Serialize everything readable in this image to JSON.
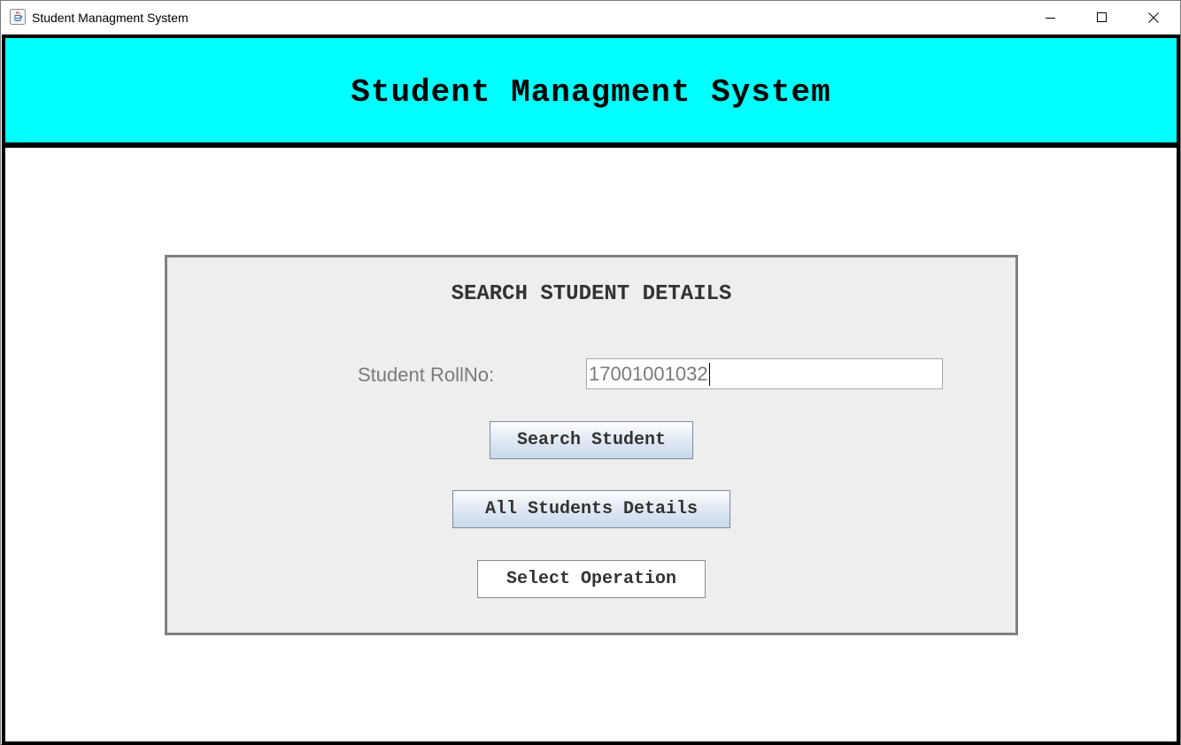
{
  "window": {
    "title": "Student Managment System",
    "controls": {
      "minimize_icon": "minimize-icon",
      "maximize_icon": "maximize-icon",
      "close_icon": "close-icon"
    }
  },
  "header": {
    "title": "Student Managment System",
    "background_color": "#00ffff"
  },
  "search_panel": {
    "title": "SEARCH STUDENT DETAILS",
    "roll_label": "Student RollNo:",
    "roll_value": "17001001032",
    "buttons": {
      "search": "Search Student",
      "all_details": "All Students Details",
      "select_operation": "Select Operation"
    }
  }
}
